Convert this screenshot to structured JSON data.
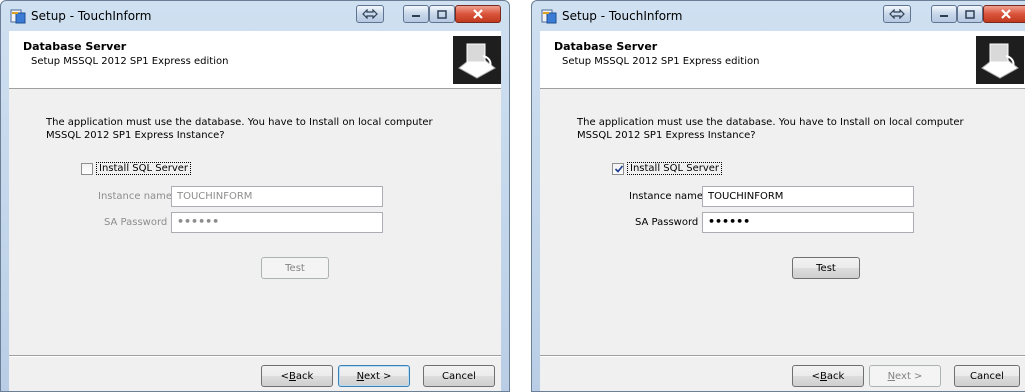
{
  "windows": [
    {
      "title": "Setup - TouchInform",
      "header": {
        "title": "Database Server",
        "subtitle": "Setup MSSQL 2012 SP1 Express edition"
      },
      "body_text": "The application must use the database. You have to Install on local computer MSSQL 2012 SP1 Express Instance?",
      "install_checkbox": {
        "label": "Install SQL Server",
        "checked": false
      },
      "instance_name": {
        "label": "Instance name",
        "value": "TOUCHINFORM",
        "enabled": false
      },
      "sa_password": {
        "label": "SA Password",
        "value": "••••••",
        "enabled": false
      },
      "test_button": {
        "label": "Test",
        "enabled": false
      },
      "back_button": {
        "label": "< Back",
        "accel": "B"
      },
      "next_button": {
        "label": "Next >",
        "accel": "N",
        "enabled": true
      },
      "cancel_button": {
        "label": "Cancel"
      }
    },
    {
      "title": "Setup - TouchInform",
      "header": {
        "title": "Database Server",
        "subtitle": "Setup MSSQL 2012 SP1 Express edition"
      },
      "body_text": "The application must use the database. You have to Install on local computer MSSQL 2012 SP1 Express Instance?",
      "install_checkbox": {
        "label": "Install SQL Server",
        "checked": true
      },
      "instance_name": {
        "label": "Instance name",
        "value": "TOUCHINFORM",
        "enabled": true
      },
      "sa_password": {
        "label": "SA Password",
        "value": "••••••",
        "enabled": true
      },
      "test_button": {
        "label": "Test",
        "enabled": true
      },
      "back_button": {
        "label": "< Back",
        "accel": "B"
      },
      "next_button": {
        "label": "Next >",
        "accel": "N",
        "enabled": false
      },
      "cancel_button": {
        "label": "Cancel"
      }
    }
  ]
}
